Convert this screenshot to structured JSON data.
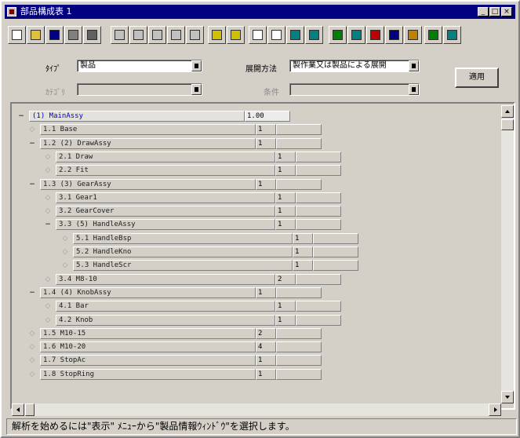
{
  "window": {
    "title": "部品構成表 1"
  },
  "title_buttons": [
    "_",
    "□",
    "×"
  ],
  "toolbar": {
    "buttons": [
      {
        "name": "new-icon",
        "color": "#ffffff"
      },
      {
        "name": "open-folder-icon",
        "color": "#e0c040"
      },
      {
        "name": "save-icon",
        "color": "#000080"
      },
      {
        "name": "print-preview-icon",
        "color": "#808080"
      },
      {
        "name": "print-icon",
        "color": "#606060"
      },
      {
        "name": "undo-icon",
        "color": "#c0c0c0"
      },
      {
        "name": "cut-icon",
        "color": "#c0c0c0"
      },
      {
        "name": "copy-icon",
        "color": "#c0c0c0"
      },
      {
        "name": "paste-icon",
        "color": "#c0c0c0"
      },
      {
        "name": "check-icon",
        "color": "#c0c0c0"
      },
      {
        "name": "filter-icon",
        "color": "#d0c000"
      },
      {
        "name": "filter-edit-icon",
        "color": "#d0c000"
      },
      {
        "name": "list-view-icon",
        "color": "#ffffff"
      },
      {
        "name": "table-view-icon",
        "color": "#ffffff"
      },
      {
        "name": "export-icon",
        "color": "#008080"
      },
      {
        "name": "import-icon",
        "color": "#008080"
      },
      {
        "name": "tree-icon",
        "color": "#008000"
      },
      {
        "name": "tree-expand-icon",
        "color": "#008080"
      },
      {
        "name": "color-icon",
        "color": "#c00000"
      },
      {
        "name": "chart-icon",
        "color": "#000080"
      },
      {
        "name": "calc-icon",
        "color": "#c08000"
      },
      {
        "name": "help-icon",
        "color": "#008000"
      },
      {
        "name": "about-icon",
        "color": "#008080"
      }
    ]
  },
  "form": {
    "type_label": "ﾀｲﾌﾟ",
    "type_value": "製品",
    "expand_method_label": "展開方法",
    "expand_method_value": "製作業又は製品による展開",
    "category_label": "ｶﾃｺﾞﾘ",
    "category_value": "",
    "condition_label": "条件",
    "condition_value": "",
    "apply_button": "適用"
  },
  "tree": {
    "rows": [
      {
        "expander": "−",
        "name": "(1) MainAssy",
        "qty": "1.00",
        "selected": true
      },
      {
        "expander": "",
        "name": "1.1 Base",
        "qty": "1"
      },
      {
        "expander": "−",
        "name": "1.2 (2) DrawAssy",
        "qty": "1"
      },
      {
        "expander": "",
        "name": "2.1 Draw",
        "qty": "1"
      },
      {
        "expander": "",
        "name": "2.2 Fit",
        "qty": "1"
      },
      {
        "expander": "−",
        "name": "1.3 (3) GearAssy",
        "qty": "1"
      },
      {
        "expander": "",
        "name": "3.1 Gear1",
        "qty": "1"
      },
      {
        "expander": "",
        "name": "3.2 GearCover",
        "qty": "1"
      },
      {
        "expander": "−",
        "name": "3.3 (5) HandleAssy",
        "qty": "1"
      },
      {
        "expander": "",
        "name": "5.1 HandleBsp",
        "qty": "1"
      },
      {
        "expander": "",
        "name": "5.2 HandleKno",
        "qty": "1"
      },
      {
        "expander": "",
        "name": "5.3 HandleScr",
        "qty": "1"
      },
      {
        "expander": "",
        "name": "3.4 M8-10",
        "qty": "2"
      },
      {
        "expander": "−",
        "name": "1.4 (4) KnobAssy",
        "qty": "1"
      },
      {
        "expander": "",
        "name": "4.1 Bar",
        "qty": "1"
      },
      {
        "expander": "",
        "name": "4.2 Knob",
        "qty": "1"
      },
      {
        "expander": "",
        "name": "1.5 M10-15",
        "qty": "2"
      },
      {
        "expander": "",
        "name": "1.6 M10-20",
        "qty": "4"
      },
      {
        "expander": "",
        "name": "1.7 StopAc",
        "qty": "1"
      },
      {
        "expander": "",
        "name": "1.8 StopRing",
        "qty": "1"
      }
    ]
  },
  "status": {
    "message": "解析を始めるには\"表示\" ﾒﾆｭｰから\"製品情報ｳｨﾝﾄﾞｳ\"を選択します。"
  }
}
